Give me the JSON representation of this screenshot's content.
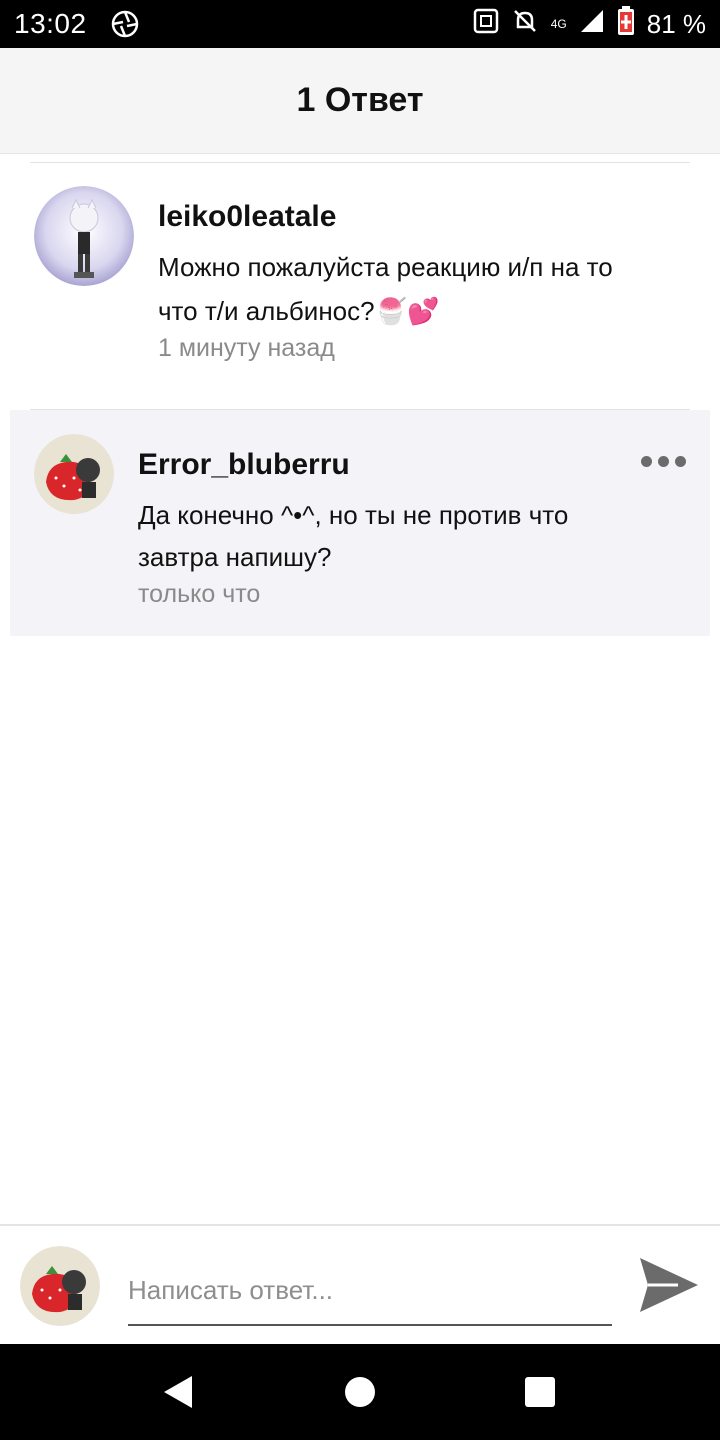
{
  "status_bar": {
    "time": "13:02",
    "network": "4G",
    "battery_percent": "81 %",
    "icons": [
      "aperture-icon",
      "nfc-icon",
      "notifications-off-icon",
      "signal-icon",
      "battery-icon"
    ]
  },
  "header": {
    "title": "1 Ответ"
  },
  "comment": {
    "username": "leiko0leatale",
    "text_line1": "Можно пожалуйста реакцию и/п на то",
    "text_line2": "что т/и альбинос?",
    "emojis": "🍧💕",
    "timestamp": "1 минуту назад"
  },
  "reply": {
    "username": "Error_bluberru",
    "text_line1": "Да конечно ^•^, но ты не против что",
    "text_line2": "завтра напишу?",
    "timestamp": "только что"
  },
  "composer": {
    "placeholder": "Написать ответ..."
  },
  "colors": {
    "header_bg": "#f5f5f5",
    "reply_bg": "#f4f3f7",
    "timestamp": "#8a8a8a",
    "send_icon": "#6b6b6b"
  }
}
